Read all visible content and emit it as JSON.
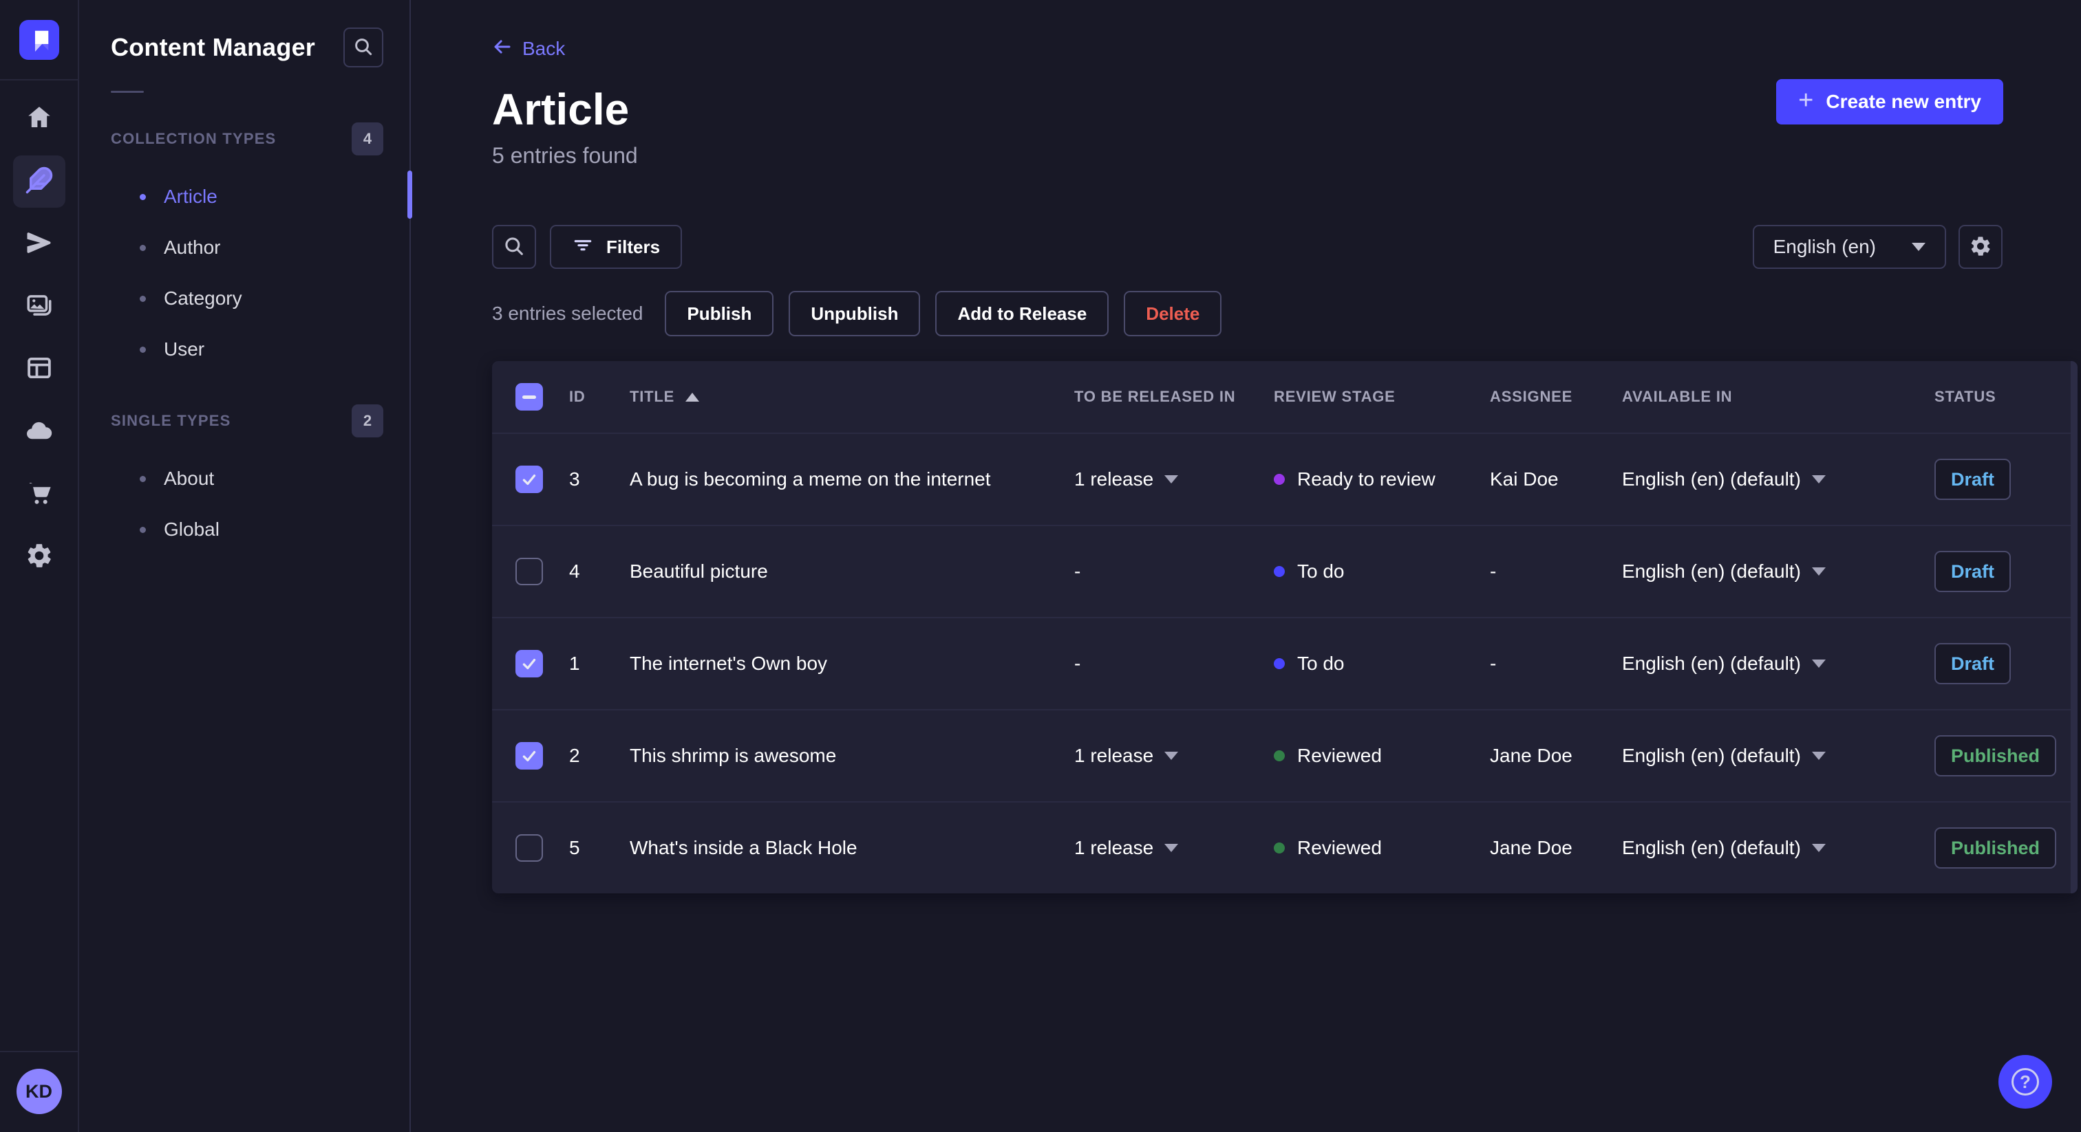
{
  "nav": {
    "items": [
      {
        "name": "home",
        "state": ""
      },
      {
        "name": "content-manager",
        "state": "active"
      },
      {
        "name": "releases",
        "state": ""
      },
      {
        "name": "media-library",
        "state": ""
      },
      {
        "name": "content-type-builder",
        "state": ""
      },
      {
        "name": "deploy",
        "state": ""
      },
      {
        "name": "marketplace",
        "state": ""
      },
      {
        "name": "settings",
        "state": ""
      }
    ],
    "avatar_initials": "KD"
  },
  "subnav": {
    "title": "Content Manager",
    "sections": [
      {
        "label": "COLLECTION TYPES",
        "count": "4",
        "items": [
          {
            "label": "Article",
            "state": "active"
          },
          {
            "label": "Author",
            "state": ""
          },
          {
            "label": "Category",
            "state": ""
          },
          {
            "label": "User",
            "state": ""
          }
        ]
      },
      {
        "label": "SINGLE TYPES",
        "count": "2",
        "items": [
          {
            "label": "About",
            "state": ""
          },
          {
            "label": "Global",
            "state": ""
          }
        ]
      }
    ]
  },
  "header": {
    "back_label": "Back",
    "title": "Article",
    "subtitle": "5 entries found",
    "create_label": "Create new entry"
  },
  "toolbar": {
    "filters_label": "Filters",
    "locale_value": "English (en)"
  },
  "selection": {
    "summary": "3 entries selected",
    "publish_label": "Publish",
    "unpublish_label": "Unpublish",
    "add_to_release_label": "Add to Release",
    "delete_label": "Delete"
  },
  "table": {
    "header_checkbox_state": "indeterminate",
    "headers": {
      "id": "ID",
      "title": "TITLE",
      "released_in": "TO BE RELEASED IN",
      "review_stage": "REVIEW STAGE",
      "assignee": "ASSIGNEE",
      "available_in": "AVAILABLE IN",
      "status": "STATUS"
    },
    "rows": [
      {
        "checkbox_state": "checked",
        "id": "3",
        "title": "A bug is becoming a meme on the internet",
        "released_in": "1 release",
        "released_caret": "",
        "review_stage": "Ready to review",
        "review_dot_color": "#9736e8",
        "assignee": "Kai Doe",
        "available_in": "English (en) (default)",
        "status": "Draft",
        "status_class": "draft"
      },
      {
        "checkbox_state": "",
        "id": "4",
        "title": "Beautiful picture",
        "released_in": "-",
        "released_caret": "hidden",
        "review_stage": "To do",
        "review_dot_color": "#4945ff",
        "assignee": "-",
        "available_in": "English (en) (default)",
        "status": "Draft",
        "status_class": "draft"
      },
      {
        "checkbox_state": "checked",
        "id": "1",
        "title": "The internet's Own boy",
        "released_in": "-",
        "released_caret": "hidden",
        "review_stage": "To do",
        "review_dot_color": "#4945ff",
        "assignee": "-",
        "available_in": "English (en) (default)",
        "status": "Draft",
        "status_class": "draft"
      },
      {
        "checkbox_state": "checked",
        "id": "2",
        "title": "This shrimp is awesome",
        "released_in": "1 release",
        "released_caret": "",
        "review_stage": "Reviewed",
        "review_dot_color": "#328048",
        "assignee": "Jane Doe",
        "available_in": "English (en) (default)",
        "status": "Published",
        "status_class": "published"
      },
      {
        "checkbox_state": "",
        "id": "5",
        "title": "What's inside a Black Hole",
        "released_in": "1 release",
        "released_caret": "",
        "review_stage": "Reviewed",
        "review_dot_color": "#328048",
        "assignee": "Jane Doe",
        "available_in": "English (en) (default)",
        "status": "Published",
        "status_class": "published"
      }
    ]
  },
  "colors": {
    "accent": "#4945ff",
    "accent_light": "#7b79ff",
    "draft_text": "#66b7f1",
    "published_text": "#5cb176",
    "danger_text": "#ee5e52",
    "card_bg": "#212134",
    "page_bg": "#181826"
  },
  "help": {
    "label": "?"
  }
}
